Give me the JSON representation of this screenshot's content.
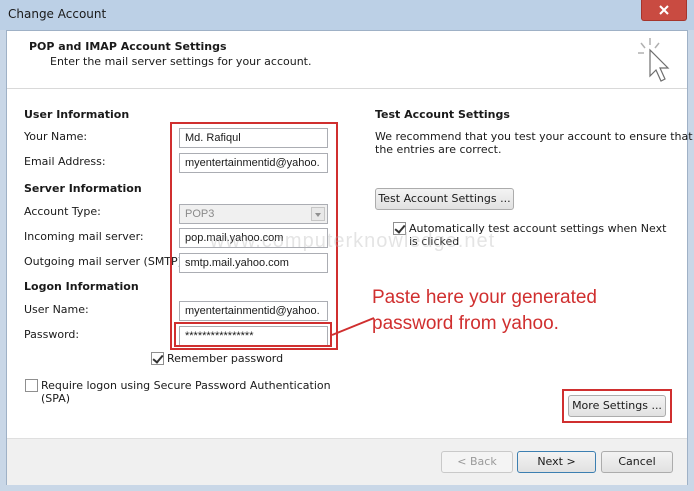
{
  "window": {
    "title": "Change Account"
  },
  "header": {
    "title": "POP and IMAP Account Settings",
    "subtitle": "Enter the mail server settings for your account."
  },
  "user_info": {
    "heading": "User Information",
    "name_label": "Your Name:",
    "name_value": "Md. Rafiqul",
    "email_label": "Email Address:",
    "email_value": "myentertainmentid@yahoo."
  },
  "server_info": {
    "heading": "Server Information",
    "account_type_label": "Account Type:",
    "account_type_value": "POP3",
    "incoming_label": "Incoming mail server:",
    "incoming_value": "pop.mail.yahoo.com",
    "outgoing_label": "Outgoing mail server (SMTP):",
    "outgoing_value": "smtp.mail.yahoo.com"
  },
  "logon_info": {
    "heading": "Logon Information",
    "username_label": "User Name:",
    "username_value": "myentertainmentid@yahoo.",
    "password_label": "Password:",
    "password_value": "****************",
    "remember_label": "Remember password",
    "remember_checked": true,
    "spa_label_line1": "Require logon using Secure Password Authentication",
    "spa_label_line2": "(SPA)",
    "spa_checked": false
  },
  "test_settings": {
    "heading": "Test Account Settings",
    "description_line1": "We recommend that you test your account to ensure that",
    "description_line2": "the entries are correct.",
    "test_button": "Test Account Settings ...",
    "auto_test_line1": "Automatically test account settings when Next",
    "auto_test_line2": "is clicked",
    "auto_test_checked": true
  },
  "buttons": {
    "more_settings": "More Settings ...",
    "back": "< Back",
    "next": "Next >",
    "cancel": "Cancel"
  },
  "annotation": {
    "line1": "Paste here your generated",
    "line2": "password from yahoo."
  },
  "watermark": "www.computerknowledge.net",
  "colors": {
    "annotation_red": "#d02f2f",
    "title_bar": "#bcd0e6",
    "close_button": "#c94b41"
  },
  "icons": {
    "header_icon": "cursor-click-icon",
    "close": "close-icon",
    "dropdown": "chevron-down-icon"
  }
}
